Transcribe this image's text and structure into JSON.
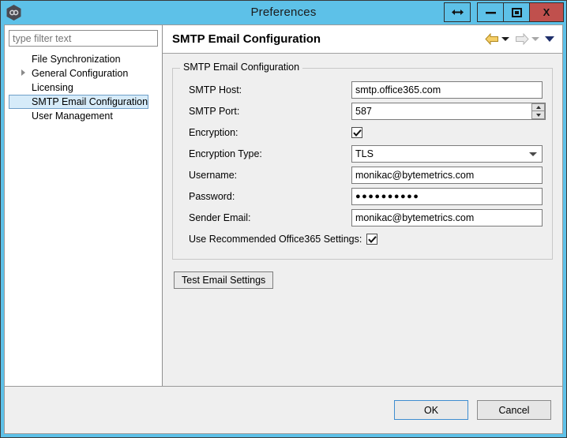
{
  "window": {
    "title": "Preferences",
    "app_icon": "app-hexagon-icon",
    "buttons": {
      "resize": "resize-horizontal-icon",
      "minimize": "minimize-icon",
      "maximize": "maximize-icon",
      "close": "X"
    },
    "colors": {
      "titlebar": "#5dc1e8",
      "close_button": "#c0504d",
      "selection": "#d6ebf9",
      "panel": "#efefef"
    }
  },
  "sidebar": {
    "filter": {
      "placeholder": "type filter text",
      "value": ""
    },
    "items": [
      {
        "label": "File Synchronization",
        "expandable": false,
        "selected": false
      },
      {
        "label": "General Configuration",
        "expandable": true,
        "selected": false
      },
      {
        "label": "Licensing",
        "expandable": false,
        "selected": false
      },
      {
        "label": "SMTP Email Configuration",
        "expandable": false,
        "selected": true
      },
      {
        "label": "User Management",
        "expandable": false,
        "selected": false
      }
    ]
  },
  "page": {
    "title": "SMTP Email Configuration",
    "nav": {
      "back_icon": "back-arrow-icon",
      "back_menu_icon": "chevron-down-icon",
      "forward_icon": "forward-arrow-icon",
      "forward_menu_icon": "chevron-down-icon",
      "menu_icon": "chevron-down-icon"
    }
  },
  "group": {
    "title": "SMTP Email Configuration",
    "fields": [
      {
        "label": "SMTP Host:",
        "type": "text",
        "value": "smtp.office365.com"
      },
      {
        "label": "SMTP Port:",
        "type": "spinner",
        "value": "587"
      },
      {
        "label": "Encryption:",
        "type": "checkbox",
        "value": "checked"
      },
      {
        "label": "Encryption Type:",
        "type": "combo",
        "value": "TLS"
      },
      {
        "label": "Username:",
        "type": "text",
        "value": "monikac@bytemetrics.com"
      },
      {
        "label": "Password:",
        "type": "password",
        "value": "●●●●●●●●●●"
      },
      {
        "label": "Sender Email:",
        "type": "text",
        "value": "monikac@bytemetrics.com"
      },
      {
        "label": "Use Recommended Office365 Settings:",
        "type": "checkbox",
        "value": "checked"
      }
    ],
    "test_button": "Test Email Settings"
  },
  "footer": {
    "ok": "OK",
    "cancel": "Cancel"
  }
}
